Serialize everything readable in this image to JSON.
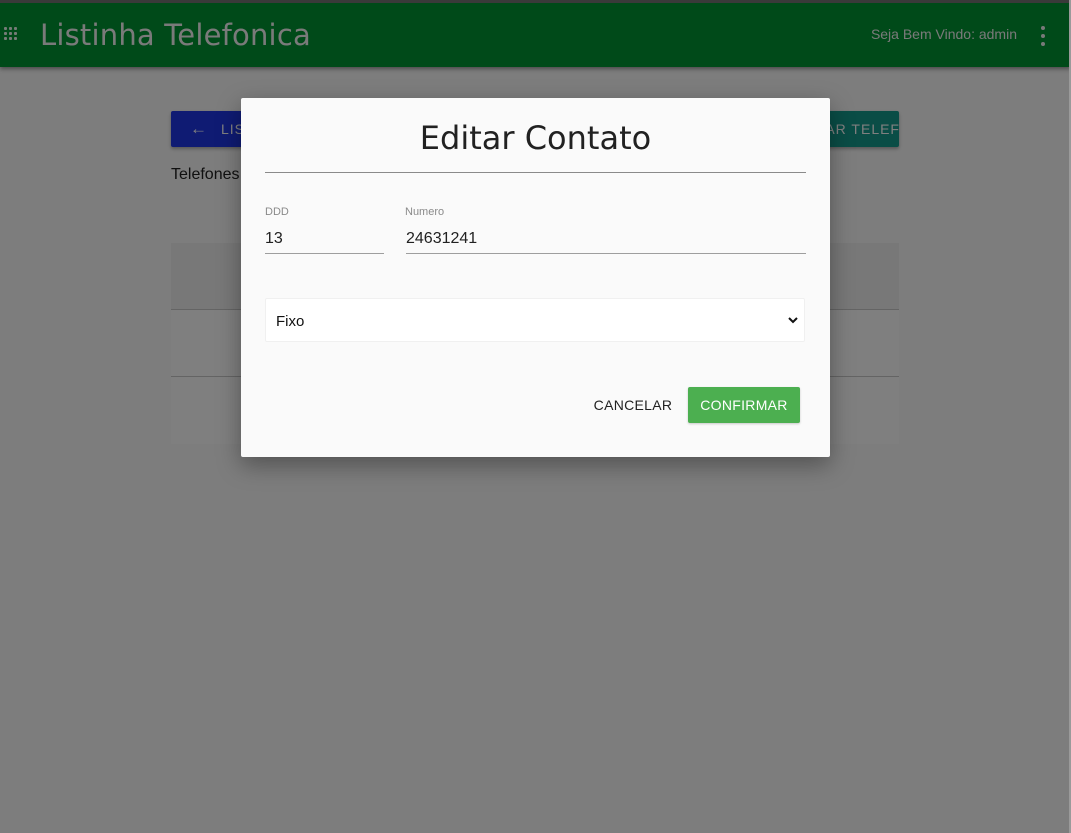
{
  "app": {
    "title": "Listinha Telefonica",
    "welcome_text": "Seja Bem Vindo: admin"
  },
  "page": {
    "back_button_label": "LISTA",
    "add_phone_label": "ADICIONAR TELEFONE",
    "phones_heading": "Telefones"
  },
  "modal": {
    "title": "Editar Contato",
    "ddd_label": "DDD",
    "ddd_value": "13",
    "numero_label": "Numero",
    "numero_value": "24631241",
    "type_selected": "Fixo",
    "cancel_label": "CANCELAR",
    "confirm_label": "CONFIRMAR"
  },
  "colors": {
    "appbar": "#009432",
    "back_button": "#1e36e6",
    "add_button": "#159a8c",
    "confirm_button": "#4caf50"
  },
  "icons": {
    "menu": "apps-grid-icon",
    "more": "more-vert-icon",
    "back": "arrow-left-icon",
    "dropdown": "chevron-down-icon"
  }
}
